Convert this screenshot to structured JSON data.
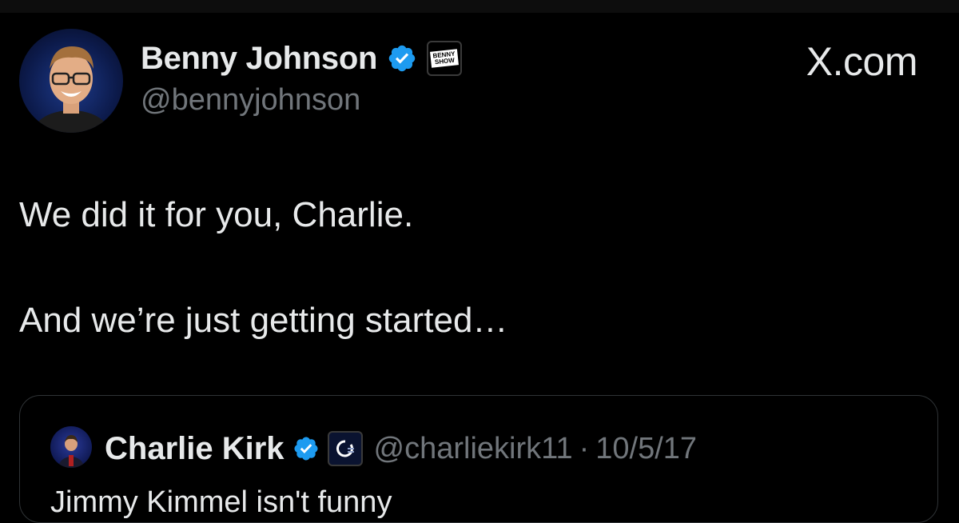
{
  "author": {
    "display_name": "Benny Johnson",
    "handle": "@bennyjohnson",
    "affiliate_badge_text": "BENNY SHOW"
  },
  "brand": {
    "label": "X.com"
  },
  "tweet": {
    "line1": "We did it for you, Charlie.",
    "line2": "And we’re just getting started…"
  },
  "quoted_tweet": {
    "display_name": "Charlie Kirk",
    "handle": "@charliekirk11",
    "separator": "·",
    "date": "10/5/17",
    "text": "Jimmy Kimmel isn't funny"
  },
  "colors": {
    "background": "#000000",
    "text_primary": "#e7e9ea",
    "text_secondary": "#71767b",
    "verified_blue": "#1d9bf0",
    "quote_border": "#2f3336"
  },
  "icons": {
    "verified": "verified-badge-icon",
    "affiliate_benny": "benny-show-badge-icon",
    "affiliate_tpusa": "turning-point-badge-icon"
  }
}
